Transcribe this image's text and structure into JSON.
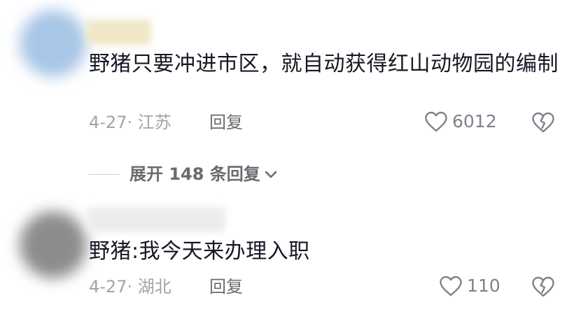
{
  "comments": [
    {
      "text": "野猪只要冲进市区，就自动获得红山动物园的编制",
      "date_location": "4-27· 江苏",
      "reply_label": "回复",
      "like_count": "6012"
    },
    {
      "text": "野猪:我今天来办理入职",
      "date_location": "4-27· 湖北",
      "reply_label": "回复",
      "like_count": "110"
    }
  ],
  "expand_replies_label": "展开 148 条回复",
  "colors": {
    "text_primary": "#161823",
    "text_secondary": "#a3a4a8",
    "text_action": "#6a6b70",
    "icon_stroke": "#80818a"
  },
  "icons": {
    "like": "heart-outline-icon",
    "dislike": "broken-heart-icon",
    "expand": "chevron-down-icon"
  }
}
